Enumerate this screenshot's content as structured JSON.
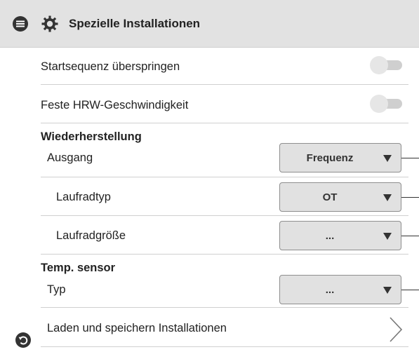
{
  "header": {
    "menu_icon": "menu-icon",
    "settings_icon": "gear-icon",
    "title": "Spezielle Installationen"
  },
  "rows": {
    "skip_start": {
      "label": "Startsequenz überspringen",
      "toggle_on": false
    },
    "fixed_speed": {
      "label": "Feste HRW-Geschwindigkeit",
      "toggle_on": false
    }
  },
  "recovery": {
    "title": "Wiederherstellung",
    "output": {
      "label": "Ausgang",
      "value": "Frequenz"
    },
    "wheel_type": {
      "label": "Laufradtyp",
      "value": "OT"
    },
    "wheel_size": {
      "label": "Laufradgröße",
      "value": "..."
    }
  },
  "temp_sensor": {
    "title": "Temp. sensor",
    "type": {
      "label": "Typ",
      "value": "..."
    }
  },
  "load_save": {
    "label": "Laden und speichern Installationen"
  },
  "footer": {
    "back_icon": "undo-icon"
  },
  "colors": {
    "header_bg": "#e2e2e2",
    "dropdown_bg": "#e1e1e1",
    "toggle_track": "#cfcfcf",
    "toggle_knob": "#e6e6e6",
    "icon_dark": "#333333"
  }
}
